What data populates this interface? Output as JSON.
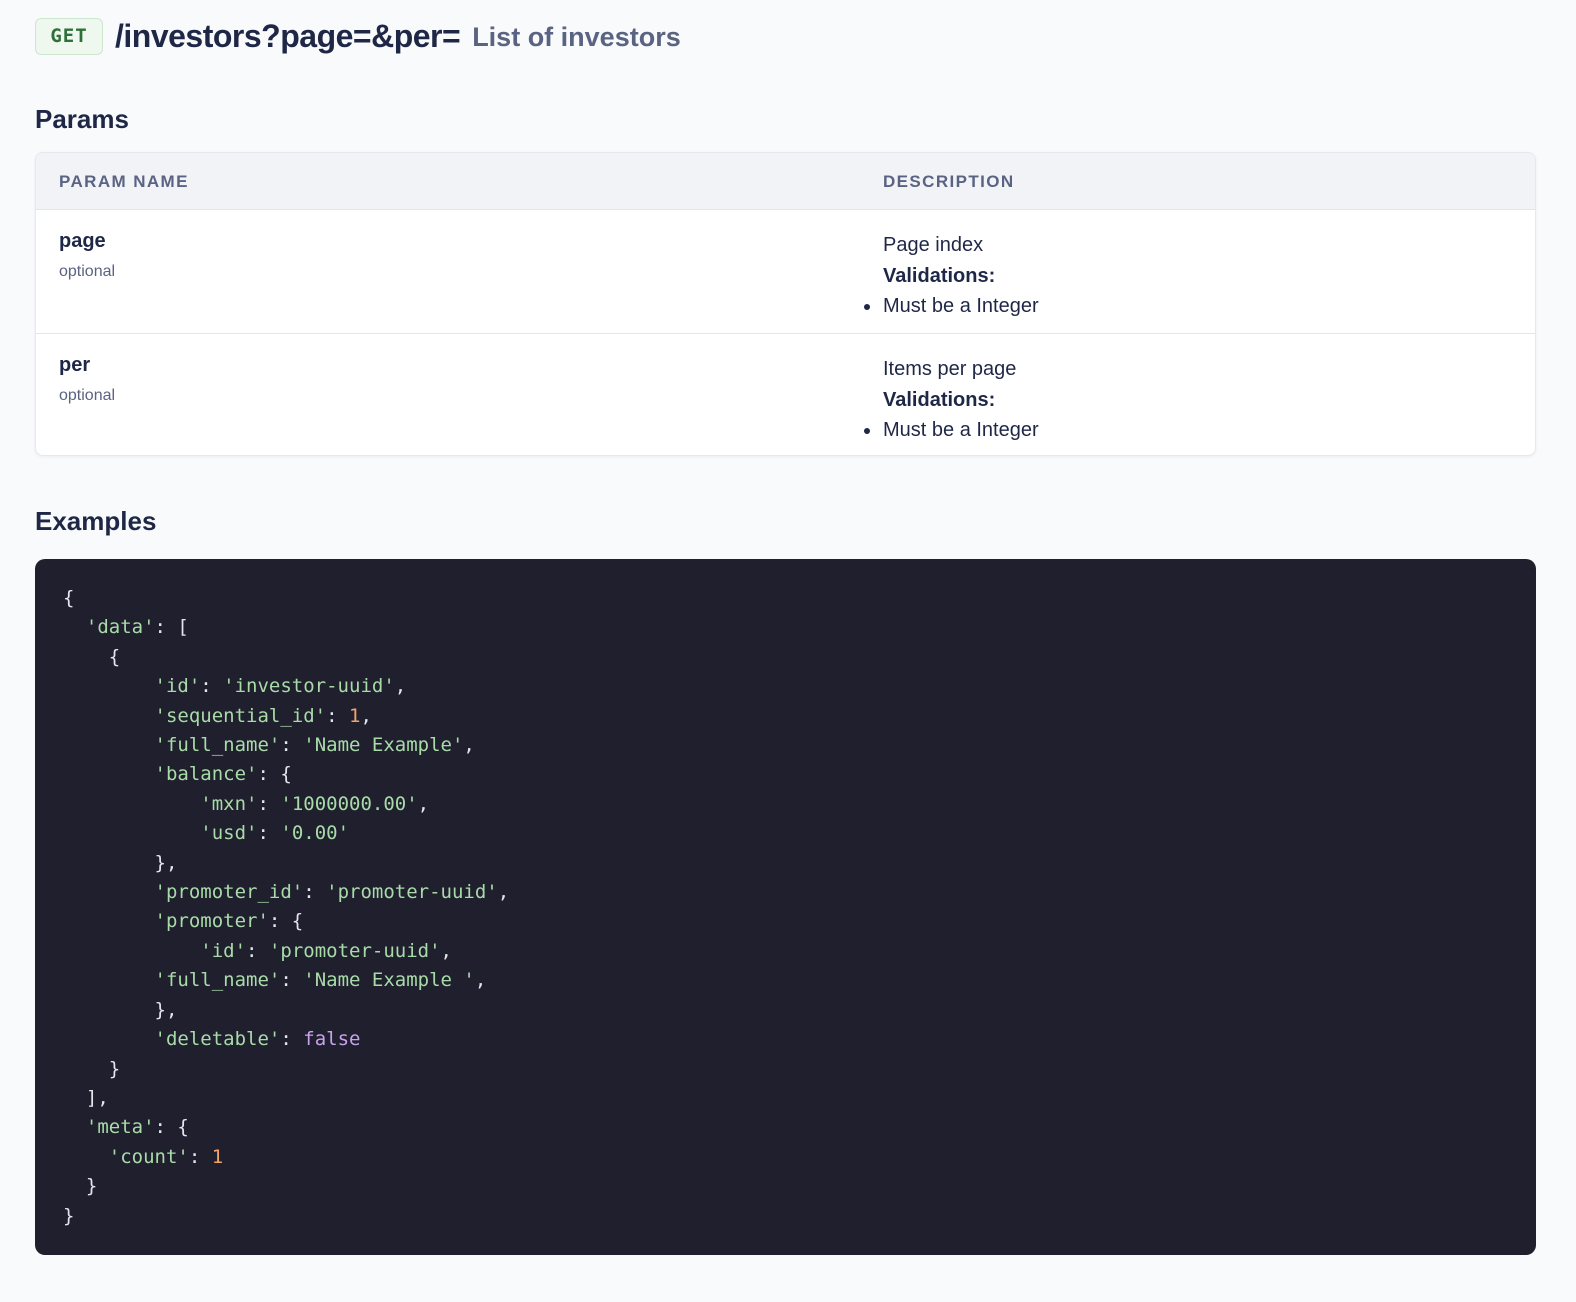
{
  "endpoint": {
    "method": "GET",
    "path": "/investors?page=&per=",
    "summary": "List of investors"
  },
  "params_section": {
    "title": "Params",
    "columns": [
      "PARAM NAME",
      "DESCRIPTION"
    ],
    "rows": [
      {
        "name": "page",
        "requirement": "optional",
        "description": "Page index",
        "validations_label": "Validations:",
        "validations": [
          "Must be a Integer"
        ]
      },
      {
        "name": "per",
        "requirement": "optional",
        "description": "Items per page",
        "validations_label": "Validations:",
        "validations": [
          "Must be a Integer"
        ]
      }
    ]
  },
  "examples_section": {
    "title": "Examples",
    "code_lines": [
      [
        [
          "pun",
          "{"
        ]
      ],
      [
        [
          "pun",
          "  "
        ],
        [
          "key",
          "'data'"
        ],
        [
          "pun",
          ": ["
        ]
      ],
      [
        [
          "pun",
          "    {"
        ]
      ],
      [
        [
          "pun",
          "        "
        ],
        [
          "key",
          "'id'"
        ],
        [
          "pun",
          ": "
        ],
        [
          "str",
          "'investor-uuid'"
        ],
        [
          "pun",
          ","
        ]
      ],
      [
        [
          "pun",
          "        "
        ],
        [
          "key",
          "'sequential_id'"
        ],
        [
          "pun",
          ": "
        ],
        [
          "num",
          "1"
        ],
        [
          "pun",
          ","
        ]
      ],
      [
        [
          "pun",
          "        "
        ],
        [
          "key",
          "'full_name'"
        ],
        [
          "pun",
          ": "
        ],
        [
          "str",
          "'Name Example'"
        ],
        [
          "pun",
          ","
        ]
      ],
      [
        [
          "pun",
          "        "
        ],
        [
          "key",
          "'balance'"
        ],
        [
          "pun",
          ": {"
        ]
      ],
      [
        [
          "pun",
          "            "
        ],
        [
          "key",
          "'mxn'"
        ],
        [
          "pun",
          ": "
        ],
        [
          "str",
          "'1000000.00'"
        ],
        [
          "pun",
          ","
        ]
      ],
      [
        [
          "pun",
          "            "
        ],
        [
          "key",
          "'usd'"
        ],
        [
          "pun",
          ": "
        ],
        [
          "str",
          "'0.00'"
        ]
      ],
      [
        [
          "pun",
          "        },"
        ]
      ],
      [
        [
          "pun",
          "        "
        ],
        [
          "key",
          "'promoter_id'"
        ],
        [
          "pun",
          ": "
        ],
        [
          "str",
          "'promoter-uuid'"
        ],
        [
          "pun",
          ","
        ]
      ],
      [
        [
          "pun",
          "        "
        ],
        [
          "key",
          "'promoter'"
        ],
        [
          "pun",
          ": {"
        ]
      ],
      [
        [
          "pun",
          "            "
        ],
        [
          "key",
          "'id'"
        ],
        [
          "pun",
          ": "
        ],
        [
          "str",
          "'promoter-uuid'"
        ],
        [
          "pun",
          ","
        ]
      ],
      [
        [
          "pun",
          "        "
        ],
        [
          "key",
          "'full_name'"
        ],
        [
          "pun",
          ": "
        ],
        [
          "str",
          "'Name Example '"
        ],
        [
          "pun",
          ","
        ]
      ],
      [
        [
          "pun",
          "        },"
        ]
      ],
      [
        [
          "pun",
          "        "
        ],
        [
          "key",
          "'deletable'"
        ],
        [
          "pun",
          ": "
        ],
        [
          "bool",
          "false"
        ]
      ],
      [
        [
          "pun",
          "    }"
        ]
      ],
      [
        [
          "pun",
          "  ],"
        ]
      ],
      [
        [
          "pun",
          "  "
        ],
        [
          "key",
          "'meta'"
        ],
        [
          "pun",
          ": {"
        ]
      ],
      [
        [
          "pun",
          "    "
        ],
        [
          "key",
          "'count'"
        ],
        [
          "pun",
          ": "
        ],
        [
          "num",
          "1"
        ]
      ],
      [
        [
          "pun",
          "  }"
        ]
      ],
      [
        [
          "pun",
          "}"
        ]
      ]
    ]
  },
  "colors": {
    "page_background": "#f9fafc",
    "heading_text": "#1f2747",
    "muted_text": "#5b6383",
    "method_badge_bg": "#eef8ee",
    "method_badge_text": "#2f6f3a",
    "code_background": "#1f1f2e",
    "code_string": "#a8dba8",
    "code_number": "#f2a46b",
    "code_boolean": "#c9a2ee"
  }
}
